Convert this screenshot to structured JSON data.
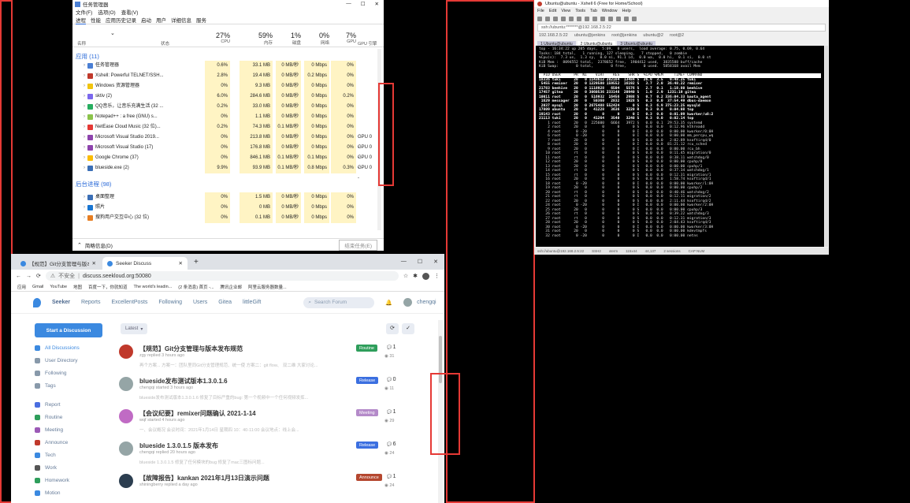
{
  "task_manager": {
    "title": "任务管理器",
    "window_controls": [
      "—",
      "☐",
      "✕"
    ],
    "menu": [
      "文件(F)",
      "选项(O)",
      "查看(V)"
    ],
    "tabs": [
      "进程",
      "性能",
      "应用历史记录",
      "启动",
      "用户",
      "详细信息",
      "服务"
    ],
    "sort_arrow": "⌄",
    "columns": [
      {
        "pct": "",
        "label": "名称"
      },
      {
        "pct": "",
        "label": "状态"
      },
      {
        "pct": "27%",
        "label": "CPU"
      },
      {
        "pct": "59%",
        "label": "内存"
      },
      {
        "pct": "1%",
        "label": "磁盘"
      },
      {
        "pct": "0%",
        "label": "网络"
      },
      {
        "pct": "7%",
        "label": "GPU"
      },
      {
        "pct": "",
        "label": "GPU 引擎"
      }
    ],
    "section_apps": "应用 (11)",
    "section_bg": "后台进程 (98)",
    "apps": [
      {
        "name": "任务管理器",
        "cpu": "0.6%",
        "mem": "33.1 MB",
        "disk": "0 MB/秒",
        "net": "0 Mbps",
        "gpu": "0%",
        "eng": "",
        "color": "#4a7fd4"
      },
      {
        "name": "Xshell: Powerful TELNET/SSH...",
        "cpu": "2.8%",
        "mem": "19.4 MB",
        "disk": "0 MB/秒",
        "net": "0.2 Mbps",
        "gpu": "0%",
        "eng": "",
        "color": "#c0392b"
      },
      {
        "name": "Windows 资源管理器",
        "cpu": "0%",
        "mem": "9.3 MB",
        "disk": "0 MB/秒",
        "net": "0 Mbps",
        "gpu": "0%",
        "eng": "",
        "color": "#f1c40f"
      },
      {
        "name": "sktiv (2)",
        "cpu": "6.0%",
        "mem": "284.6 MB",
        "disk": "0 MB/秒",
        "net": "0 Mbps",
        "gpu": "0.2%",
        "eng": "",
        "color": "#7b68ee"
      },
      {
        "name": "QQ音乐，让音乐充满生活 (32 ...",
        "cpu": "0.2%",
        "mem": "33.0 MB",
        "disk": "0 MB/秒",
        "net": "0 Mbps",
        "gpu": "0%",
        "eng": "",
        "color": "#27ae60"
      },
      {
        "name": "Notepad++ : a free (GNU) s...",
        "cpu": "0%",
        "mem": "1.1 MB",
        "disk": "0 MB/秒",
        "net": "0 Mbps",
        "gpu": "0%",
        "eng": "",
        "color": "#8bc34a"
      },
      {
        "name": "NetEase Cloud Music (32 位)...",
        "cpu": "0.2%",
        "mem": "74.3 MB",
        "disk": "0.1 MB/秒",
        "net": "0 Mbps",
        "gpu": "0%",
        "eng": "",
        "color": "#e53935"
      },
      {
        "name": "Microsoft Visual Studio 2019...",
        "cpu": "0%",
        "mem": "213.8 MB",
        "disk": "0 MB/秒",
        "net": "0 Mbps",
        "gpu": "0%",
        "eng": "GPU 0 -",
        "color": "#8e44ad"
      },
      {
        "name": "Microsoft Visual Studio (17)",
        "cpu": "0%",
        "mem": "176.8 MB",
        "disk": "0 MB/秒",
        "net": "0 Mbps",
        "gpu": "0%",
        "eng": "GPU 0 -",
        "color": "#8e44ad"
      },
      {
        "name": "Google Chrome (37)",
        "cpu": "0%",
        "mem": "846.1 MB",
        "disk": "0.1 MB/秒",
        "net": "0.1 Mbps",
        "gpu": "0%",
        "eng": "GPU 0 -",
        "color": "#fbbc05"
      },
      {
        "name": "blueside.exe (2)",
        "cpu": "9.9%",
        "mem": "93.9 MB",
        "disk": "0.1 MB/秒",
        "net": "0.8 Mbps",
        "gpu": "0.3%",
        "eng": "GPU 0 -",
        "color": "#3b6fb6"
      }
    ],
    "bg": [
      {
        "name": "桌面整理",
        "cpu": "0%",
        "mem": "1.5 MB",
        "disk": "0 MB/秒",
        "net": "0 Mbps",
        "gpu": "0%",
        "eng": "",
        "color": "#3b6fb6"
      },
      {
        "name": "照片",
        "cpu": "0%",
        "mem": "0 MB",
        "disk": "0 MB/秒",
        "net": "0 Mbps",
        "gpu": "0%",
        "eng": "",
        "color": "#1976d2"
      },
      {
        "name": "搜狗用户交互中心 (32 位)",
        "cpu": "0%",
        "mem": "0.1 MB",
        "disk": "0 MB/秒",
        "net": "0 Mbps",
        "gpu": "0%",
        "eng": "",
        "color": "#e67e22"
      }
    ],
    "footer_less": "简略信息(D)",
    "footer_end": "结束任务(E)"
  },
  "browser": {
    "tabs": [
      {
        "label": "【规范】Git分支管理与版本发布..."
      },
      {
        "label": "Seeker Discuss"
      }
    ],
    "new_tab": "+",
    "tab_close": "✕",
    "window_controls": [
      "—",
      "☐",
      "✕"
    ],
    "nav_buttons": [
      "←",
      "→",
      "⟳"
    ],
    "url_prefix": "不安全",
    "url": "discuss.seekloud.org:50080",
    "bookmarks": [
      "应用",
      "Gmail",
      "YouTube",
      "地图",
      "百度一下，你就知道",
      "The world's leadin...",
      "(2 条消息) 首页 -...",
      "腾讯企业邮",
      "阿里云服务器数量..."
    ],
    "forum": {
      "brand": "Seeker",
      "nav": [
        "Reports",
        "ExcellentPosts",
        "Following",
        "Users",
        "Gitea",
        "littleGift"
      ],
      "search_placeholder": "Search Forum",
      "user": "chengqi",
      "start_btn": "Start a Discussion",
      "sort": "Latest",
      "sidebar": [
        {
          "label": "All Discussions",
          "color": "#3b89e0"
        },
        {
          "label": "User Directory",
          "color": "#8899aa"
        },
        {
          "label": "Following",
          "color": "#8899aa"
        },
        {
          "label": "Tags",
          "color": "#8899aa"
        },
        {
          "label": "Report",
          "color": "#4a6ee0"
        },
        {
          "label": "Routine",
          "color": "#2e9e5b"
        },
        {
          "label": "Meeting",
          "color": "#9b59b6"
        },
        {
          "label": "Announce",
          "color": "#c0392b"
        },
        {
          "label": "Tech",
          "color": "#3b89e0"
        },
        {
          "label": "Work",
          "color": "#555555"
        },
        {
          "label": "Homework",
          "color": "#2e9e5b"
        },
        {
          "label": "Motion",
          "color": "#3b89e0"
        }
      ],
      "discussions": [
        {
          "title": "【规范】Git分支管理与版本发布规范",
          "meta": "zgy replied 3 hours ago",
          "excerpt": "再个方案... 方案一：团队里同Git分支管理规范、统一使 方案二：git flow、 双二维 大家讨论...",
          "tag": "Routine",
          "tag_color": "#2e9e5b",
          "replies": "1",
          "views": "31",
          "avatar": "#c0392b"
        },
        {
          "title": "blueside发布测试版本1.3.0.1.6",
          "meta": "chengqi started 3 hours ago",
          "excerpt": "blueside发布测试版本1.3.0.1.6 修复了目标严重的bug: 第一个视频中一个任何视频发挥...",
          "tag": "Release",
          "tag_color": "#3b6fe0",
          "replies": "0",
          "views": "11",
          "avatar": "#95a5a6"
        },
        {
          "title": "【会议纪要】remixer问题确认 2021-1-14",
          "meta": "wqf started 4 hours ago",
          "excerpt": "一、会议概况 会议时间：2021年1月14日 星期四 10：40-11:00 会议地点：线上会...",
          "tag": "Meeting",
          "tag_color": "#b48ac9",
          "replies": "1",
          "views": "29",
          "avatar": "#c06bc4"
        },
        {
          "title": "blueside 1.3.0.1.5 版本发布",
          "meta": "chengqi replied 20 hours ago",
          "excerpt": "blueside 1.3.0.1.5 修复了任何模块的bug 修复了mac三图标问题...",
          "tag": "Release",
          "tag_color": "#3b6fe0",
          "replies": "6",
          "views": "24",
          "avatar": "#95a5a6"
        },
        {
          "title": "【故障报告】kankan 2021年1月13日演示问题",
          "meta": "shiningberry replied a day ago",
          "excerpt": "",
          "tag": "Announce",
          "tag_color": "#b5472f",
          "replies": "1",
          "views": "24",
          "avatar": "#2c3e50"
        }
      ]
    }
  },
  "xshell": {
    "title": "Ubuntu@ubuntu - Xshell 6 (Free for Home/School)",
    "menu": [
      "File",
      "Edit",
      "View",
      "Tools",
      "Tab",
      "Window",
      "Help"
    ],
    "address": "ssh://ubuntu:*******@192.168.2.5:22",
    "sessions": [
      "192.168.2.5:22",
      "ubuntu@jenkins",
      "root@jenkins",
      "ubuntu@2",
      "root@2"
    ],
    "tabs": [
      "1 Ubuntu@ubuntu",
      "2 Ubuntu@ubuntu",
      "3 Ubuntu@ubuntu"
    ],
    "status": [
      "ssh://ubuntu@192.168.2.5:22",
      "SSH2",
      "xterm",
      "115x44",
      "44,137",
      "2 sessions",
      "CAP NUM"
    ],
    "top_lines": [
      "top - 16:34:22 up 205 days,  5:09,  0 users,  load average: 0.75, 0.69, 0.64",
      "Tasks: 184 total,   1 running, 127 sleeping,   7 stopped,   0 zombie",
      "%Cpu(s):  7.3 us,  1.3 sy,  0.0 ni, 91.1 id,  0.0 wa,  0.0 hi,  0.1 si,  0.0 st",
      "KiB Mem :  8094552 total,  2378652 free,  1904412 used,  3835588 buff/cache",
      "KiB Swap:        0 total,        0 free,        0 used.  5858168 avail Mem",
      ""
    ],
    "top_header": "  PID USER      PR  NI    VIRT    RES    SHR S  %CPU %MEM     TIME+ COMMAND",
    "top_rows": [
      "18336 tuki      20   0 1143612 282164  13484 S  26.9  3.5   9:48.25 tuki",
      " 5455 remixer   20   0 1229580 159552  16192 S   3.7  2.0  36:48.22 remixer",
      "21783 beehive   20   0 1118928   6504   5576 S   2.7  0.1   1:18.80 beehive",
      "17457 gitea     20   0 3060536 233148  20940 S   1.0  2.9  1231:19 gitea",
      "10011 root      20   0  516932  16456   2988 S   0.7  0.2 336:04.33 baota_agent",
      " 1629 messager  20   0   50360   2832   1928 S   0.3  0.0  37:54.49 dbus-daemon",
      " 2037 mysql     20   0 2675488 552424      0 S   0.3  6.9 375:23.25 mysqld",
      "17809 ubuntu    20   0   41228   3636   3220 R   0.3  0.0   0:04.08 top",
      "19143 root      20   0       0      0      0 I   0.3  0.0   0:01.09 kworker/u8:2",
      "21113 tuki      20   0   41264   3540   3240 S   0.3  0.0   0:02.14 top",
      "    1 root      20   0  225600   6664   3972 S   0.0  0.1  29:53.35 systemd",
      "    2 root      20   0       0      0      0 S   0.0  0.0   0:12.96 kthreadd",
      "    4 root       0 -20       0      0      0 I   0.0  0.0   0:00.00 kworker/0:0H",
      "    6 root       0 -20       0      0      0 I   0.0  0.0   0:00.00 mm_percpu_wq",
      "    7 root      20   0       0      0      0 S   0.0  0.0   2:02.89 ksoftirqd/0",
      "    8 root      20   0       0      0      0 I   0.0  0.0  81:21.12 rcu_sched",
      "    9 root      20   0       0      0      0 I   0.0  0.0   0:00.00 rcu_bh",
      "   10 root      rt   0       0      0      0 S   0.0  0.0   0:11.45 migration/0",
      "   11 root      rt   0       0      0      0 S   0.0  0.0   0:38.11 watchdog/0",
      "   12 root      20   0       0      0      0 S   0.0  0.0   0:00.00 cpuhp/0",
      "   13 root      20   0       0      0      0 S   0.0  0.0   0:00.00 cpuhp/1",
      "   14 root      rt   0       0      0      0 S   0.0  0.0   0:37.34 watchdog/1",
      "   15 root      rt   0       0      0      0 S   0.0  0.0   0:12.31 migration/1",
      "   16 root      20   0       0      0      0 S   0.0  0.0   1:58.74 ksoftirqd/1",
      "   18 root       0 -20       0      0      0 I   0.0  0.0   0:00.00 kworker/1:0H",
      "   19 root      20   0       0      0      0 S   0.0  0.0   0:00.00 cpuhp/2",
      "   20 root      rt   0       0      0      0 S   0.0  0.0   0:40.46 watchdog/2",
      "   21 root      rt   0       0      0      0 S   0.0  0.0   0:12.11 migration/2",
      "   22 root      20   0       0      0      0 S   0.0  0.0   2:11.44 ksoftirqd/2",
      "   24 root       0 -20       0      0      0 I   0.0  0.0   0:00.00 kworker/2:0H",
      "   25 root      20   0       0      0      0 S   0.0  0.0   0:00.00 cpuhp/3",
      "   26 root      rt   0       0      0      0 S   0.0  0.0   0:39.22 watchdog/3",
      "   27 root      rt   0       0      0      0 S   0.0  0.0   0:12.31 migration/3",
      "   28 root      20   0       0      0      0 S   0.0  0.0   2:04.43 ksoftirqd/3",
      "   30 root       0 -20       0      0      0 I   0.0  0.0   0:00.00 kworker/3:0H",
      "   31 root      20   0       0      0      0 S   0.0  0.0   0:00.00 kdevtmpfs",
      "   32 root       0 -20       0      0      0 I   0.0  0.0   0:00.00 netns"
    ]
  }
}
